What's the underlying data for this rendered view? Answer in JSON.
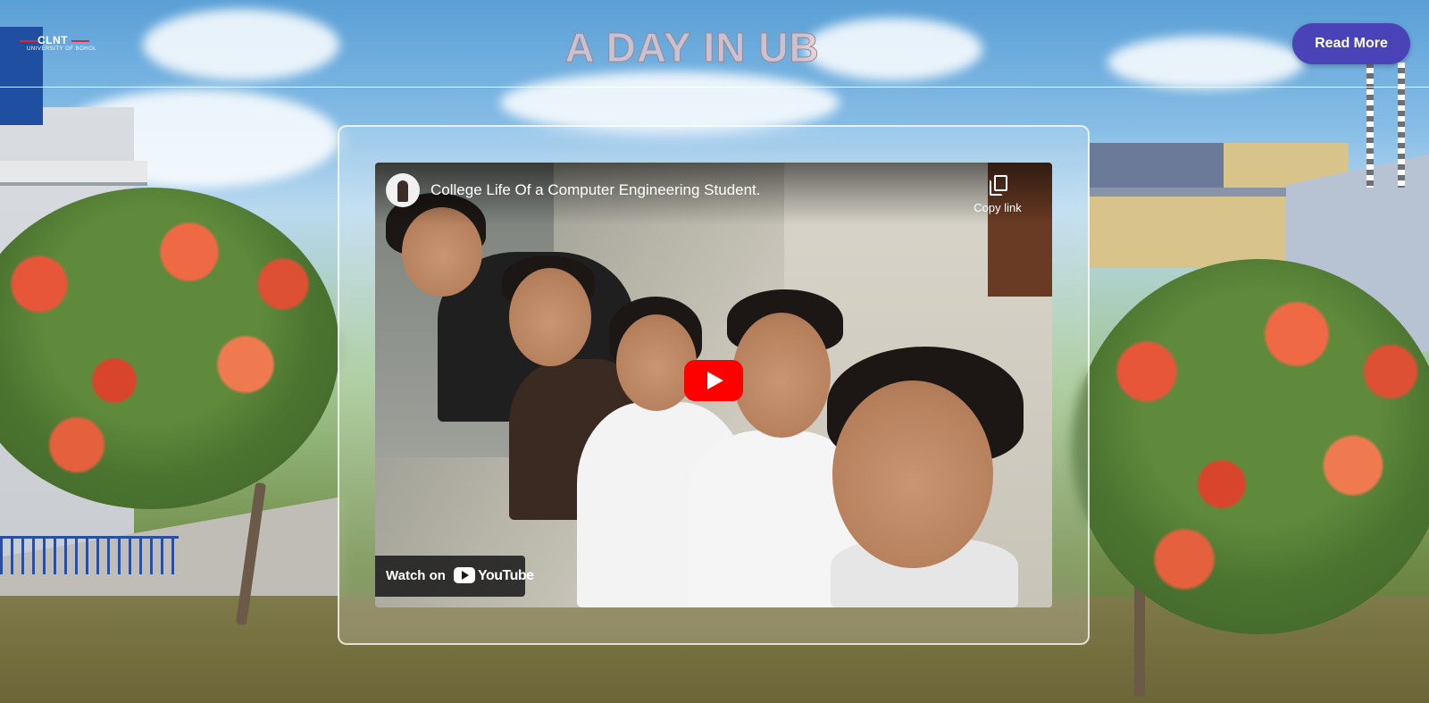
{
  "header": {
    "logo_text": "CLNT",
    "logo_subtext": "UNIVERSITY OF BOHOL",
    "title": "A DAY IN UB",
    "read_more_label": "Read More"
  },
  "video": {
    "title": "College Life Of a Computer Engineering Student.",
    "copy_link_label": "Copy link",
    "watch_on_label": "Watch on",
    "platform_label": "YouTube"
  },
  "colors": {
    "button_bg": "#4a43b8",
    "play_red": "#ff0000",
    "title_fill": "#ebc8cd"
  },
  "icons": {
    "play": "play-icon",
    "copy": "copy-icon",
    "youtube": "youtube-icon"
  }
}
